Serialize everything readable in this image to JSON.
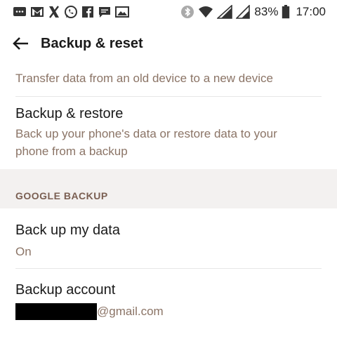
{
  "status_bar": {
    "battery_percent": "83%",
    "time": "17:00"
  },
  "app_bar": {
    "title": "Backup & reset"
  },
  "items": [
    {
      "subtitle": "Transfer data from an old device to a new device"
    },
    {
      "title": "Backup & restore",
      "subtitle_line1": "Back up your phone's data or restore data to your",
      "subtitle_line2": "phone from a backup"
    }
  ],
  "section": {
    "label": "GOOGLE BACKUP"
  },
  "google_items": [
    {
      "title": "Back up my data",
      "subtitle": "On"
    },
    {
      "title": "Backup account",
      "email_suffix": "@gmail.com"
    }
  ],
  "colors": {
    "subtitle": "#8b7466",
    "section_bg": "#f3f1f0",
    "section_label": "#7a5f52"
  }
}
